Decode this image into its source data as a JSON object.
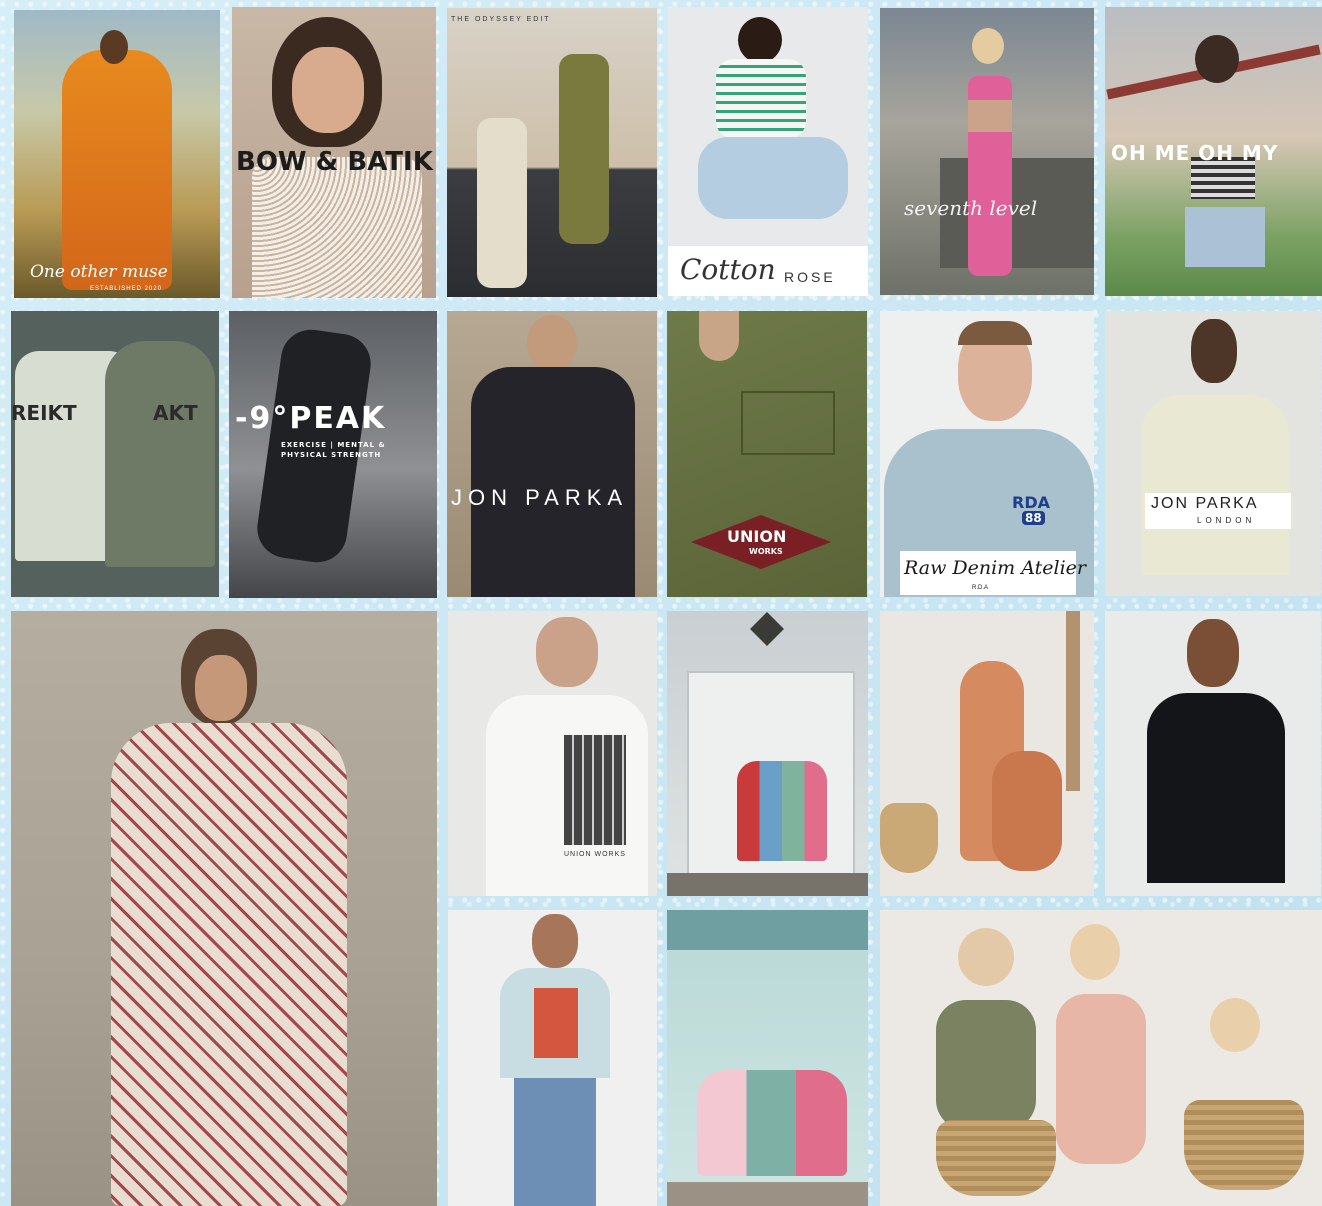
{
  "tiles": [
    {
      "id": "one-other-muse",
      "caption": "One other muse",
      "subcaption": "ESTABLISHED 2020"
    },
    {
      "id": "bow-batik",
      "caption": "BOW & BATIK"
    },
    {
      "id": "beach-duo",
      "caption": "THE ODYSSEY EDIT"
    },
    {
      "id": "cotton-rose",
      "caption": "Cotton",
      "caption2": "ROSE"
    },
    {
      "id": "seventh-level",
      "caption": "seventh level"
    },
    {
      "id": "oh-me-oh-my",
      "caption": "OH ME OH MY"
    },
    {
      "id": "reikt",
      "caption": "REIKT",
      "caption2": "AKT"
    },
    {
      "id": "peak",
      "caption": "-9°PEAK",
      "subcaption": "EXERCISE | MENTAL &",
      "subcaption2": "PHYSICAL STRENGTH"
    },
    {
      "id": "jon-parka-hood",
      "caption": "JON PARKA"
    },
    {
      "id": "union-works",
      "caption": "UNION",
      "caption2": "WORKS"
    },
    {
      "id": "raw-denim",
      "caption": "Raw Denim Atelier",
      "subcaption": "R.D.A",
      "badge": "RDA",
      "badge2": "88"
    },
    {
      "id": "jon-parka-tee",
      "caption": "JON PARKA",
      "subcaption": "LONDON"
    },
    {
      "id": "jumpsuit",
      "caption": ""
    },
    {
      "id": "union-back",
      "caption": "UNION WORKS"
    },
    {
      "id": "kids-door",
      "caption": ""
    },
    {
      "id": "kids-sitting",
      "caption": ""
    },
    {
      "id": "black-tee",
      "caption": ""
    },
    {
      "id": "graphic-tee",
      "caption": ""
    },
    {
      "id": "kids-beach-hut",
      "caption": ""
    },
    {
      "id": "toddlers",
      "caption": ""
    }
  ],
  "colors": {
    "background": "#cfe9f4",
    "orange_dress": "#e8841c",
    "olive": "#6f7a4a",
    "pink": "#e0609a",
    "union_red": "#7a1f24"
  }
}
